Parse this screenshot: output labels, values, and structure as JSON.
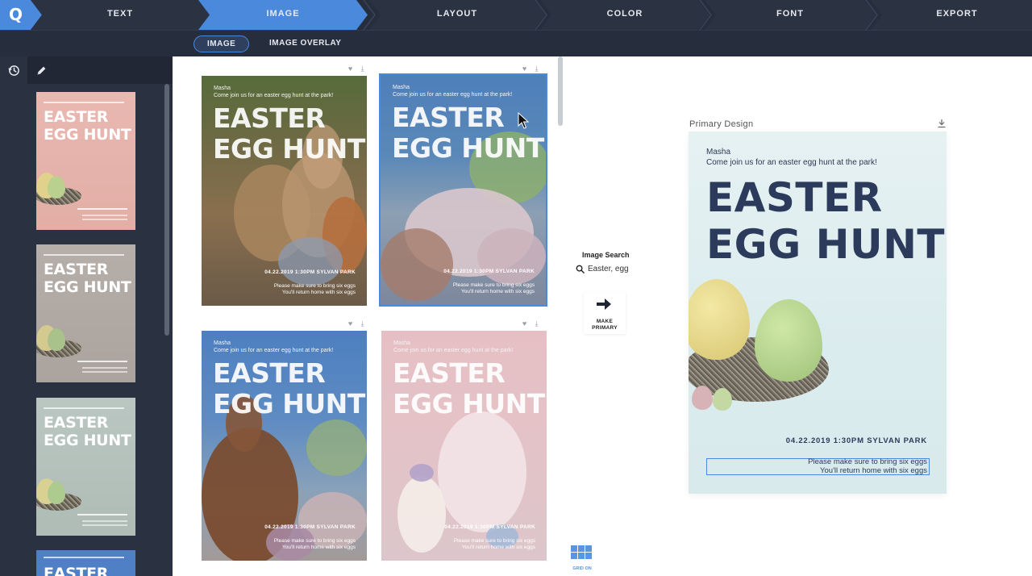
{
  "steps": [
    {
      "label": "TEXT",
      "active": false
    },
    {
      "label": "IMAGE",
      "active": true
    },
    {
      "label": "LAYOUT",
      "active": false
    },
    {
      "label": "COLOR",
      "active": false
    },
    {
      "label": "FONT",
      "active": false
    },
    {
      "label": "EXPORT",
      "active": false
    }
  ],
  "logo_letter": "Q",
  "subtabs": [
    {
      "label": "IMAGE",
      "active": true
    },
    {
      "label": "IMAGE OVERLAY",
      "active": false
    }
  ],
  "colors": {
    "accent": "#4a89dc",
    "nav_bg": "#262d3c",
    "panel_bg": "#2a3140",
    "title_dark": "#2c3b5c"
  },
  "history_thumbs": [
    {
      "title_l1": "EASTER",
      "title_l2": "EGG HUNT",
      "bg": "#e6b4ad"
    },
    {
      "title_l1": "EASTER",
      "title_l2": "EGG HUNT",
      "bg": "#b4aca6"
    },
    {
      "title_l1": "EASTER",
      "title_l2": "EGG HUNT",
      "bg": "#b6c3be"
    },
    {
      "title_l1": "EASTER",
      "bg": "#4f7fc4"
    }
  ],
  "cards": [
    {
      "name": "Masha",
      "subtitle": "Come join us for an easter egg hunt at the park!",
      "title_l1": "EASTER",
      "title_l2": "EGG HUNT",
      "date": "04.22.2019 1:30PM SYLVAN PARK",
      "note1": "Please make sure to bring six eggs",
      "note2": "You'll return home with six eggs"
    },
    {
      "name": "Masha",
      "subtitle": "Come join us for an easter egg hunt at the park!",
      "title_l1": "EASTER",
      "title_l2": "EGG HUNT",
      "date": "04.22.2019 1:30PM SYLVAN PARK",
      "note1": "Please make sure to bring six eggs",
      "note2": "You'll return home with six eggs"
    },
    {
      "name": "Masha",
      "subtitle": "Come join us for an easter egg hunt at the park!",
      "title_l1": "EASTER",
      "title_l2": "EGG HUNT",
      "date": "04.22.2019 1:30PM SYLVAN PARK",
      "note1": "Please make sure to bring six eggs",
      "note2": "You'll return home with six eggs"
    },
    {
      "name": "Masha",
      "subtitle": "Come join us for an easter egg hunt at the park!",
      "title_l1": "EASTER",
      "title_l2": "EGG HUNT",
      "date": "04.22.2019 1:30PM SYLVAN PARK",
      "note1": "Please make sure to bring six eggs",
      "note2": "You'll return home with six eggs"
    }
  ],
  "image_search": {
    "label": "Image Search",
    "query": "Easter, egg"
  },
  "make_primary": {
    "line1": "MAKE",
    "line2": "PRIMARY"
  },
  "grid_toggle": {
    "label": "GRID ON"
  },
  "primary": {
    "section_label": "Primary Design",
    "name": "Masha",
    "subtitle": "Come join us for an easter egg hunt at the park!",
    "title_l1": "EASTER",
    "title_l2": "EGG HUNT",
    "date": "04.22.2019 1:30PM SYLVAN PARK",
    "note1": "Please make sure to bring six eggs",
    "note2": "You'll return home with six eggs"
  },
  "icons": [
    "history-icon",
    "pencil-icon",
    "chevron-left-icon",
    "heart-icon",
    "download-icon",
    "search-icon",
    "arrow-right-icon",
    "grid-icon",
    "cursor-icon"
  ]
}
